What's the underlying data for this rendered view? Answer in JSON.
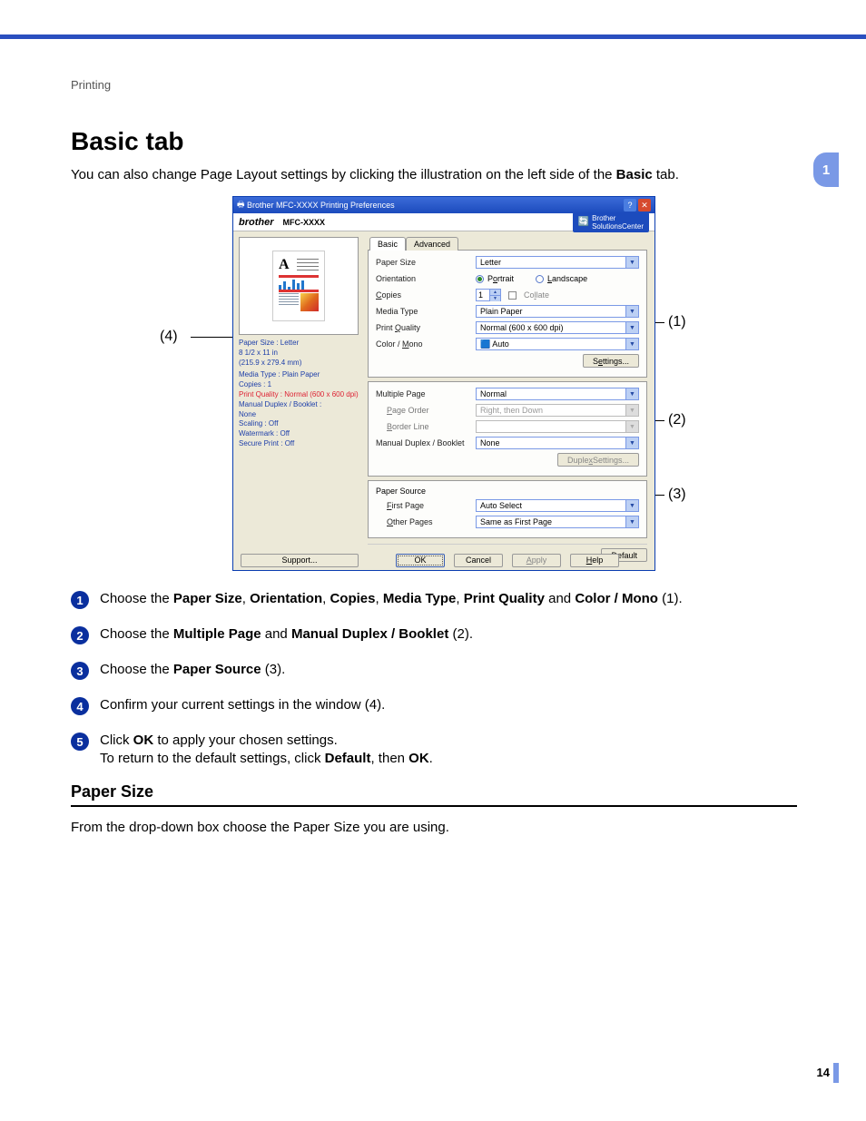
{
  "header": {
    "section": "Printing"
  },
  "chapter": "1",
  "page_number": "14",
  "title": "Basic tab",
  "intro": {
    "pre": "You can also change Page Layout settings by clicking the illustration on the left side of the ",
    "bold": "Basic",
    "post": " tab."
  },
  "dialog": {
    "title": "Brother MFC-XXXX Printing Preferences",
    "title_icon": "printer-icon",
    "brand": "brother",
    "model": "MFC-XXXX",
    "solutions": {
      "label1": "Brother",
      "label2": "SolutionsCenter"
    },
    "tabs": {
      "basic": "Basic",
      "advanced": "Advanced"
    },
    "labels": {
      "paper_size": "Paper Size",
      "orientation": "Orientation",
      "copies": "Copies",
      "media_type": "Media Type",
      "print_quality": "Print Quality",
      "color_mono": "Color / Mono",
      "settings_btn": "Settings...",
      "multiple_page": "Multiple Page",
      "page_order": "Page Order",
      "border_line": "Border Line",
      "duplex_booklet": "Manual Duplex / Booklet",
      "duplex_settings_btn": "Duplex Settings...",
      "paper_source": "Paper Source",
      "first_page": "First Page",
      "other_pages": "Other Pages",
      "default_btn": "Default",
      "support_btn": "Support...",
      "ok": "OK",
      "cancel": "Cancel",
      "apply": "Apply",
      "help": "Help",
      "portrait": "Portrait",
      "landscape": "Landscape",
      "collate": "Collate"
    },
    "values": {
      "paper_size": "Letter",
      "copies": "1",
      "media_type": "Plain Paper",
      "print_quality": "Normal (600 x 600 dpi)",
      "color_mono": "Auto",
      "multiple_page": "Normal",
      "page_order": "Right, then Down",
      "border_line": "",
      "duplex_booklet": "None",
      "first_page": "Auto Select",
      "other_pages": "Same as First Page"
    },
    "status": {
      "l1a": "Paper Size : Letter",
      "l1b": "8 1/2 x 11 in",
      "l1c": "(215.9 x 279.4 mm)",
      "l2": "Media Type : Plain Paper",
      "l3": "Copies : 1",
      "l4": "Print Quality : Normal (600 x 600 dpi)",
      "l5a": "Manual Duplex / Booklet :",
      "l5b": "None",
      "l6": "Scaling : Off",
      "l7": "Watermark : Off",
      "l8": "Secure Print : Off"
    }
  },
  "callouts": {
    "c1": "(1)",
    "c2": "(2)",
    "c3": "(3)",
    "c4": "(4)"
  },
  "steps": {
    "n1": "1",
    "n2": "2",
    "n3": "3",
    "n4": "4",
    "n5": "5",
    "s1": {
      "t0": "Choose the ",
      "b1": "Paper Size",
      "t1": ", ",
      "b2": "Orientation",
      "t2": ", ",
      "b3": "Copies",
      "t3": ", ",
      "b4": "Media Type",
      "t4": ", ",
      "b5": "Print Quality",
      "t5": " and ",
      "b6": "Color / Mono",
      "t6": " (1)."
    },
    "s2": {
      "t0": "Choose the ",
      "b1": "Multiple Page",
      "t1": " and ",
      "b2": "Manual Duplex / Booklet",
      "t2": " (2)."
    },
    "s3": {
      "t0": "Choose the ",
      "b1": "Paper Source",
      "t1": " (3)."
    },
    "s4": {
      "t0": "Confirm your current settings in the window (4)."
    },
    "s5": {
      "t0": "Click ",
      "b1": "OK",
      "t1": " to apply your chosen settings.",
      "t2": "To return to the default settings, click ",
      "b2": "Default",
      "t3": ", then ",
      "b3": "OK",
      "t4": "."
    }
  },
  "subsection": {
    "heading": "Paper Size",
    "body": "From the drop-down box choose the Paper Size you are using."
  }
}
